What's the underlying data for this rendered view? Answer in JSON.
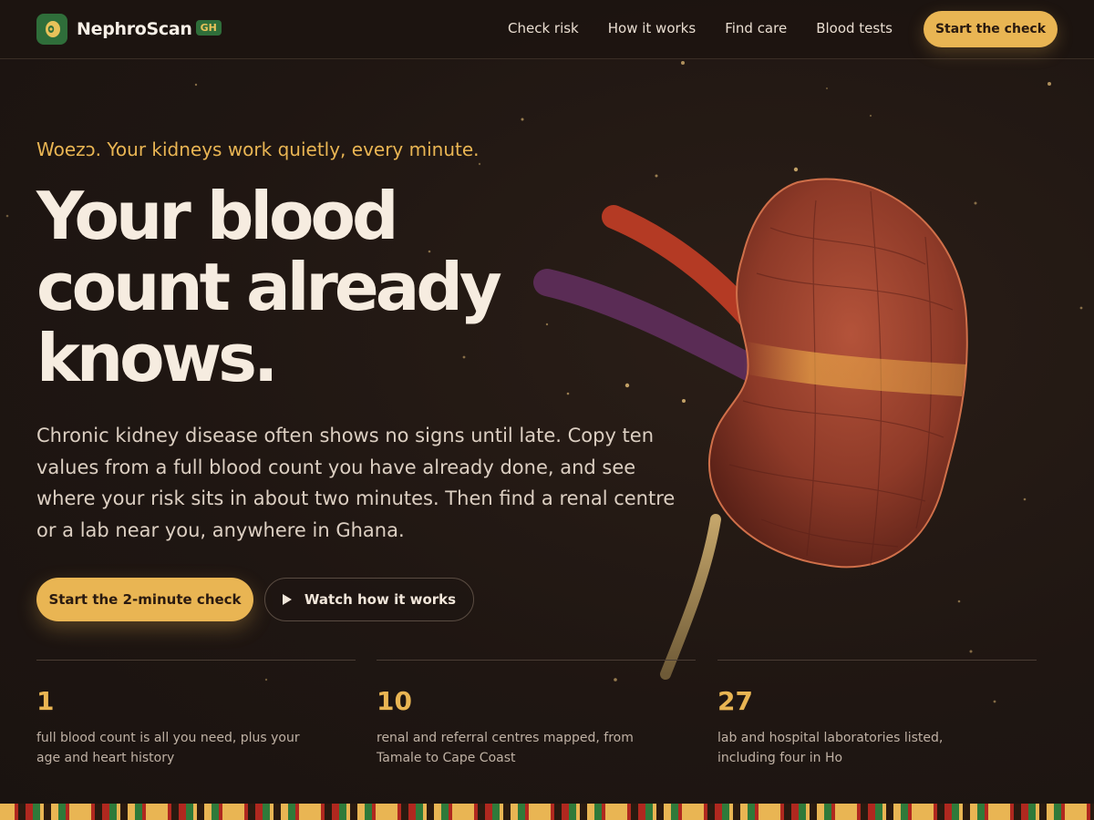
{
  "brand": {
    "name": "NephroScan",
    "badge": "GH"
  },
  "nav": {
    "items": [
      "Check risk",
      "How it works",
      "Find care",
      "Blood tests"
    ],
    "cta": "Start the check"
  },
  "hero": {
    "kicker": "Woezɔ. Your kidneys work quietly, every minute.",
    "headline": "Your blood count already knows.",
    "intro": "Chronic kidney disease often shows no signs until late. Copy ten values from a full blood count you have already done, and see where your risk sits in about two minutes. Then find a renal centre or a lab near you, anywhere in Ghana.",
    "primary_cta": "Start the 2-minute check",
    "secondary_cta": "Watch how it works"
  },
  "stats": [
    {
      "value": "1",
      "text": "full blood count is all you need, plus your age and heart history"
    },
    {
      "value": "10",
      "text": "renal and referral centres mapped, from Tamale to Cape Coast"
    },
    {
      "value": "27",
      "text": "lab and hospital laboratories listed, including four in Ho"
    }
  ],
  "colors": {
    "accent": "#e9b553",
    "background": "#1f1612",
    "brand_green": "#2f6e3a"
  },
  "icons": {
    "logo": "kidney-logo-icon",
    "play": "play-icon"
  }
}
